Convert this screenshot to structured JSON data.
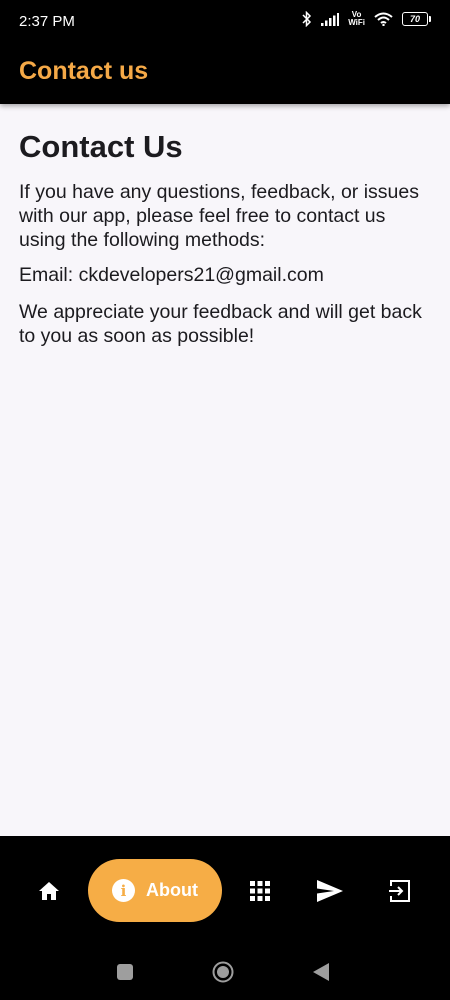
{
  "status_bar": {
    "time": "2:37 PM",
    "vowifi_top": "Vo",
    "vowifi_bottom": "WiFi",
    "battery": "70"
  },
  "app_bar": {
    "title": "Contact us"
  },
  "content": {
    "heading": "Contact Us",
    "intro": "If you have any questions, feedback, or issues with our app, please feel free to contact us using the following methods:",
    "email": "Email: ckdevelopers21@gmail.com",
    "closing": "We appreciate your feedback and will get back to you as soon as possible!"
  },
  "bottom_nav": {
    "items": [
      {
        "icon": "home-icon"
      },
      {
        "icon": "info-icon",
        "label": "About",
        "active": true
      },
      {
        "icon": "grid-icon"
      },
      {
        "icon": "send-icon"
      },
      {
        "icon": "exit-icon"
      }
    ],
    "active_color": "#f6ad46"
  },
  "colors": {
    "accent": "#f5a947",
    "background": "#f8f6fa",
    "bar": "#000000"
  }
}
